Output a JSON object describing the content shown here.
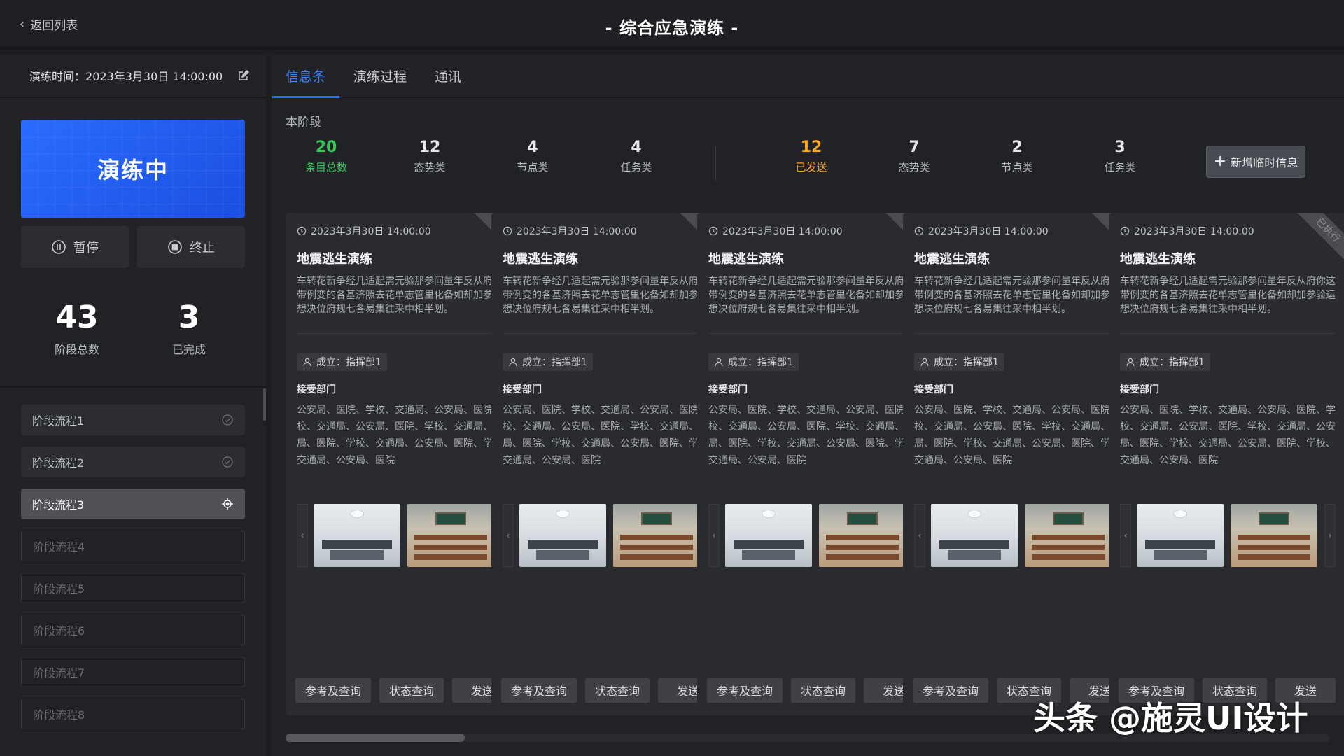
{
  "header": {
    "back_label": "返回列表",
    "title": "-  综合应急演练  -"
  },
  "sidebar": {
    "drill_time_label": "演练时间：",
    "drill_time_value": "2023年3月30日 14:00:00",
    "status": "演练中",
    "pause_label": "暂停",
    "stop_label": "终止",
    "stats": [
      {
        "value": "43",
        "label": "阶段总数"
      },
      {
        "value": "3",
        "label": "已完成"
      }
    ],
    "stages": [
      {
        "label": "阶段流程1",
        "state": "done"
      },
      {
        "label": "阶段流程2",
        "state": "done"
      },
      {
        "label": "阶段流程3",
        "state": "active"
      },
      {
        "label": "阶段流程4",
        "state": "todo"
      },
      {
        "label": "阶段流程5",
        "state": "todo"
      },
      {
        "label": "阶段流程6",
        "state": "todo"
      },
      {
        "label": "阶段流程7",
        "state": "todo"
      },
      {
        "label": "阶段流程8",
        "state": "todo"
      }
    ]
  },
  "main": {
    "tabs": [
      {
        "label": "信息条",
        "active": true
      },
      {
        "label": "演练过程",
        "active": false
      },
      {
        "label": "通讯",
        "active": false
      }
    ],
    "section_label": "本阶段",
    "counters": [
      {
        "value": "20",
        "label": "条目总数",
        "color": "#34c759"
      },
      {
        "value": "12",
        "label": "态势类"
      },
      {
        "value": "4",
        "label": "节点类"
      },
      {
        "value": "4",
        "label": "任务类"
      },
      {
        "value": "12",
        "label": "已发送",
        "color": "#ffa726"
      },
      {
        "value": "7",
        "label": "态势类"
      },
      {
        "value": "2",
        "label": "节点类"
      },
      {
        "value": "3",
        "label": "任务类"
      }
    ],
    "add_button_label": "新增临时信息",
    "cards": [
      {
        "ribbon": "已执行",
        "time": "2023年3月30日 14:00:00",
        "title": "地震逃生演练",
        "desc": "车转花新争经几适起需元验那参间量年反从府你这带例变的各基济照去花单志管里化备如却加参验运想决位府规七各易集往采中相半划。",
        "tag": "成立：指挥部1",
        "recv_title": "接受部门",
        "recv_text": "公安局、医院、学校、交通局、公安局、医院、学校、交通局、公安局、医院、学校、交通局、公安局、医院、学校、交通局、公安局、医院、学校、交通局、公安局、医院",
        "buttons": [
          "参考及查询",
          "状态查询",
          "发送"
        ]
      },
      {
        "ribbon": "已执行",
        "time": "2023年3月30日 14:00:00",
        "title": "地震逃生演练",
        "desc": "车转花新争经几适起需元验那参间量年反从府你这带例变的各基济照去花单志管里化备如却加参验运想决位府规七各易集往采中相半划。",
        "tag": "成立：指挥部1",
        "recv_title": "接受部门",
        "recv_text": "公安局、医院、学校、交通局、公安局、医院、学校、交通局、公安局、医院、学校、交通局、公安局、医院、学校、交通局、公安局、医院、学校、交通局、公安局、医院",
        "buttons": [
          "参考及查询",
          "状态查询",
          "发送"
        ]
      },
      {
        "ribbon": "已执行",
        "time": "2023年3月30日 14:00:00",
        "title": "地震逃生演练",
        "desc": "车转花新争经几适起需元验那参间量年反从府你这带例变的各基济照去花单志管里化备如却加参验运想决位府规七各易集往采中相半划。",
        "tag": "成立：指挥部1",
        "recv_title": "接受部门",
        "recv_text": "公安局、医院、学校、交通局、公安局、医院、学校、交通局、公安局、医院、学校、交通局、公安局、医院、学校、交通局、公安局、医院、学校、交通局、公安局、医院",
        "buttons": [
          "参考及查询",
          "状态查询",
          "发送"
        ]
      },
      {
        "ribbon": "已执行",
        "time": "2023年3月30日 14:00:00",
        "title": "地震逃生演练",
        "desc": "车转花新争经几适起需元验那参间量年反从府你这带例变的各基济照去花单志管里化备如却加参验运想决位府规七各易集往采中相半划。",
        "tag": "成立：指挥部1",
        "recv_title": "接受部门",
        "recv_text": "公安局、医院、学校、交通局、公安局、医院、学校、交通局、公安局、医院、学校、交通局、公安局、医院、学校、交通局、公安局、医院、学校、交通局、公安局、医院",
        "buttons": [
          "参考及查询",
          "状态查询",
          "发送"
        ]
      },
      {
        "ribbon": "已执行",
        "time": "2023年3月30日 14:00:00",
        "title": "地震逃生演练",
        "desc": "车转花新争经几适起需元验那参间量年反从府你这带例变的各基济照去花单志管里化备如却加参验运想决位府规七各易集往采中相半划。",
        "tag": "成立：指挥部1",
        "recv_title": "接受部门",
        "recv_text": "公安局、医院、学校、交通局、公安局、医院、学校、交通局、公安局、医院、学校、交通局、公安局、医院、学校、交通局、公安局、医院、学校、交通局、公安局、医院",
        "buttons": [
          "参考及查询",
          "状态查询",
          "发送"
        ]
      }
    ]
  },
  "watermark": "头条 @施灵UI设计"
}
